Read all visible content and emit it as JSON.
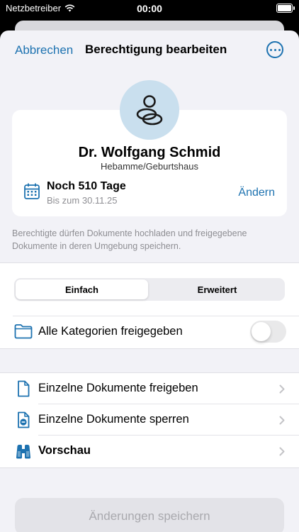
{
  "status_bar": {
    "carrier": "Netzbetreiber",
    "time": "00:00"
  },
  "nav": {
    "cancel_label": "Abbrechen",
    "title": "Berechtigung bearbeiten",
    "more_icon": "ellipsis-circle-icon"
  },
  "profile": {
    "name": "Dr. Wolfgang Schmid",
    "role": "Hebamme/Geburtshaus",
    "duration": "Noch 510 Tage",
    "until": "Bis zum 30.11.25",
    "change_label": "Ändern"
  },
  "info_text": "Berechtigte dürfen Dokumente hochladen und freigegebene Dokumente in deren Umgebung speichern.",
  "segment": {
    "options": [
      "Einfach",
      "Erweitert"
    ],
    "selected": "Einfach"
  },
  "all_categories": {
    "label": "Alle Kategorien freigegeben",
    "enabled": false
  },
  "actions": [
    {
      "label": "Einzelne Dokumente freigeben",
      "icon": "document-icon"
    },
    {
      "label": "Einzelne Dokumente sperren",
      "icon": "document-lock-icon"
    },
    {
      "label": "Vorschau",
      "icon": "binoculars-icon"
    }
  ],
  "save_label": "Änderungen speichern",
  "colors": {
    "accent": "#1d72b0",
    "background": "#f2f2f7",
    "avatar_bg": "#c9dfee"
  }
}
